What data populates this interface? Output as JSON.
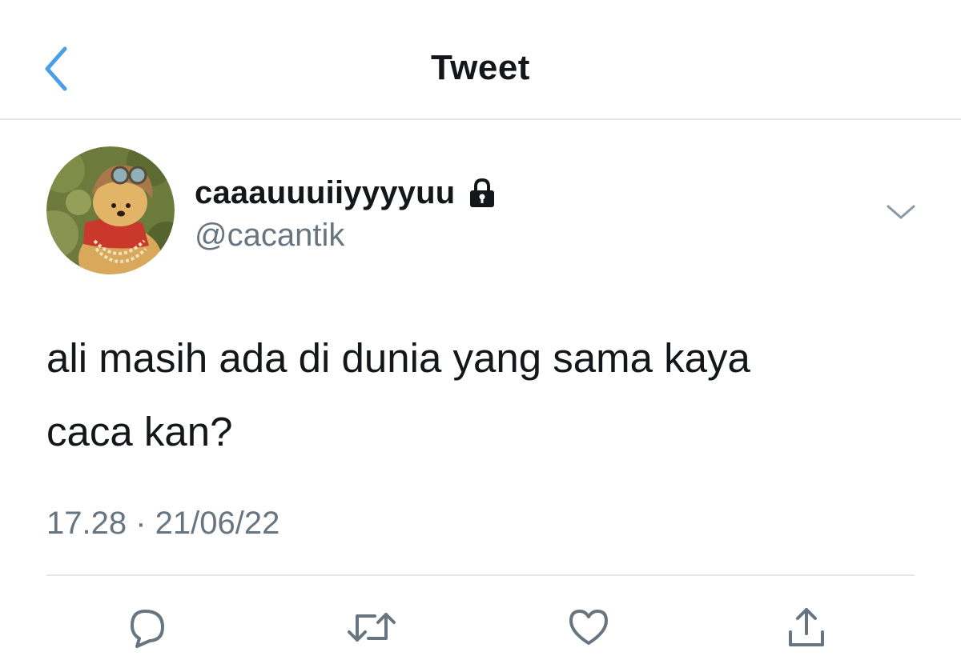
{
  "header": {
    "title": "Tweet",
    "back_icon": "chevron-left-icon",
    "accent": "#4a9fe8"
  },
  "author": {
    "display_name": "caaauuuiiyyyyuu",
    "handle": "@cacantik",
    "protected": true,
    "lock_icon": "lock-icon",
    "avatar": "avatar"
  },
  "tweet": {
    "text_line1": "ali masih ada di dunia yang sama kaya",
    "text_line2": "caca kan?",
    "timestamp": "17.28 · 21/06/22"
  },
  "actions": [
    {
      "icon": "reply-icon"
    },
    {
      "icon": "retweet-icon"
    },
    {
      "icon": "like-icon"
    },
    {
      "icon": "share-icon"
    }
  ],
  "colors": {
    "text": "#14171a",
    "secondary": "#66757f",
    "divider": "#e3e5e8",
    "icon": "#66757f"
  }
}
